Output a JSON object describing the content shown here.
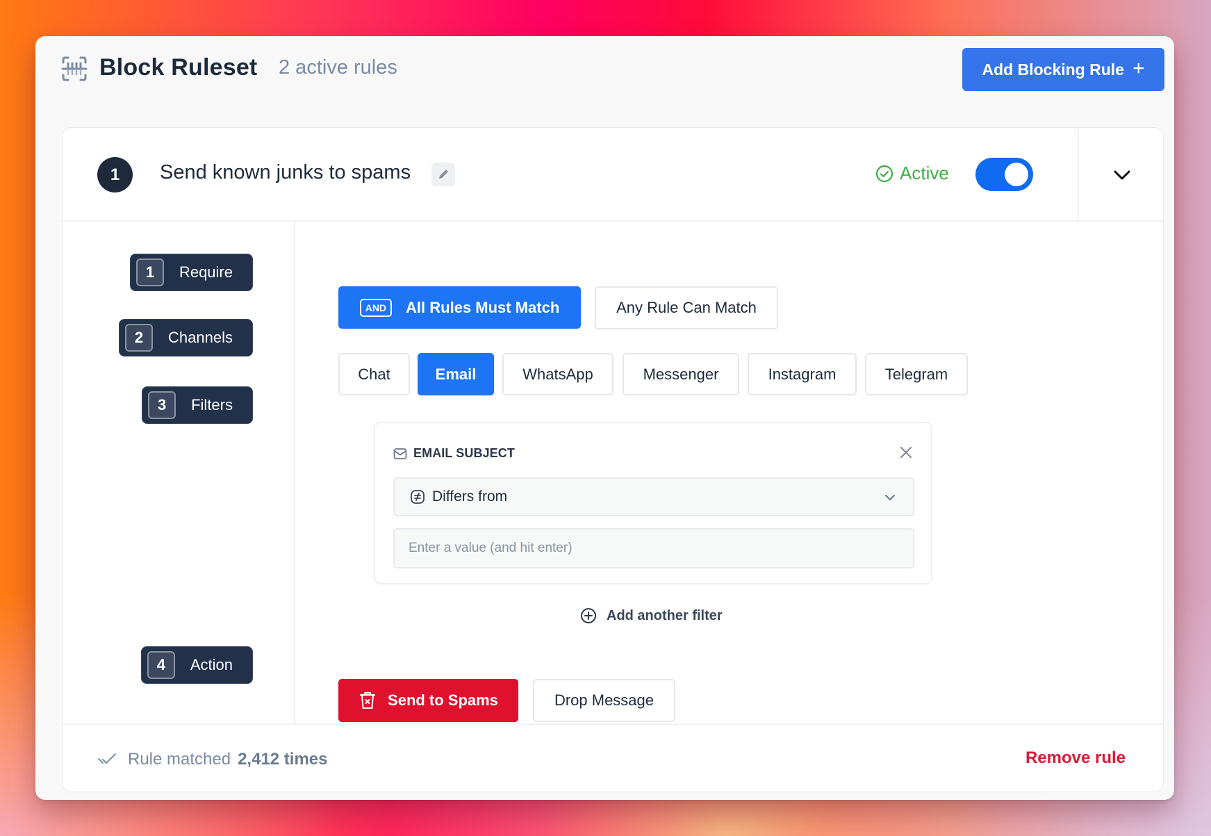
{
  "header": {
    "icon": "barcode-scan-icon",
    "title": "Block Ruleset",
    "subtitle": "2 active rules",
    "add_button_label": "Add Blocking Rule",
    "add_button_icon": "plus-icon"
  },
  "rule": {
    "number": "1",
    "title": "Send known junks to spams",
    "edit_icon": "pencil-icon",
    "status_label": "Active",
    "status_icon": "check-circle-icon",
    "enabled": true,
    "collapse_icon": "chevron-down-icon",
    "steps": [
      {
        "number": "1",
        "label": "Require"
      },
      {
        "number": "2",
        "label": "Channels"
      },
      {
        "number": "3",
        "label": "Filters"
      },
      {
        "number": "4",
        "label": "Action"
      }
    ],
    "require": {
      "options": [
        {
          "tag": "AND",
          "label": "All Rules Must Match",
          "selected": true
        },
        {
          "label": "Any Rule Can Match",
          "selected": false
        }
      ]
    },
    "channels": [
      {
        "label": "Chat",
        "selected": false
      },
      {
        "label": "Email",
        "selected": true
      },
      {
        "label": "WhatsApp",
        "selected": false
      },
      {
        "label": "Messenger",
        "selected": false
      },
      {
        "label": "Instagram",
        "selected": false
      },
      {
        "label": "Telegram",
        "selected": false
      }
    ],
    "filter": {
      "field_icon": "envelope-icon",
      "field_label": "EMAIL SUBJECT",
      "operator_icon": "not-equal-icon",
      "operator": "Differs from",
      "value": "",
      "value_placeholder": "Enter a value (and hit enter)",
      "add_label": "Add another filter",
      "add_icon": "plus-circle-icon"
    },
    "actions": [
      {
        "label": "Send to Spams",
        "icon": "trash-x-icon",
        "selected": true
      },
      {
        "label": "Drop Message",
        "selected": false
      }
    ],
    "footer": {
      "matched_prefix": "Rule matched",
      "matched_count": "2,412 times",
      "matched_icon": "double-check-icon",
      "remove_label": "Remove rule"
    }
  },
  "colors": {
    "primary": "#1d74f5",
    "add_button": "#3674ec",
    "navy": "#1e2a3b",
    "success": "#3bb043",
    "danger": "#e0102f",
    "muted": "#7b8ba1"
  }
}
